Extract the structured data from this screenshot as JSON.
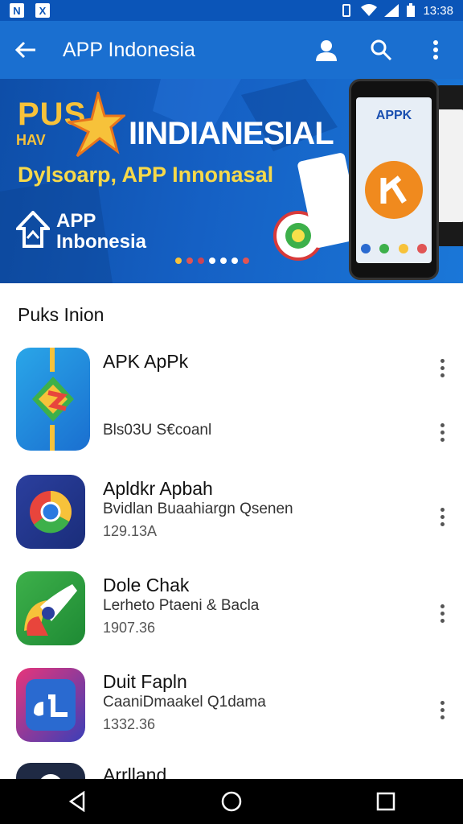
{
  "status_bar": {
    "time": "13:38",
    "left_icons": [
      "notification-icon",
      "app-icon"
    ]
  },
  "app_bar": {
    "title": "APP Indonesia",
    "actions": [
      "account-icon",
      "search-icon",
      "more-vert-icon"
    ]
  },
  "banner": {
    "line1": "PUS",
    "line2": "HAV",
    "headline": "IINDIANESIAL",
    "subtitle": "Dylsoarp, APP Innonasal",
    "logo_line1": "APP",
    "logo_line2": "Inbonesia",
    "phone_label": "APPK",
    "carousel_dots": [
      "#f7c23a",
      "#e05555",
      "#cc4455",
      "#ffffff",
      "#ffffff",
      "#ffffff",
      "#e05555"
    ]
  },
  "section": {
    "title": "Puks Inion"
  },
  "apps": [
    {
      "name": "APK ApPk",
      "developer": "Bls03U S€coanl",
      "size": ""
    },
    {
      "name": "Apldkr Apbah",
      "developer": "Bvidlan Buaahiargn Qsenen",
      "size": "129.13A"
    },
    {
      "name": "Dole Chak",
      "developer": "Lerheto Ptaeni & Bacla",
      "size": "1907.36"
    },
    {
      "name": "Duit Fapln",
      "developer": "CaaniDmaakel Q1dama",
      "size": "1332.36"
    },
    {
      "name": "Arrlland",
      "developer": "",
      "size": ""
    }
  ],
  "colors": {
    "status_bar": "#0b55b8",
    "app_bar": "#1a6fd0",
    "accent_yellow": "#f7c23a"
  }
}
